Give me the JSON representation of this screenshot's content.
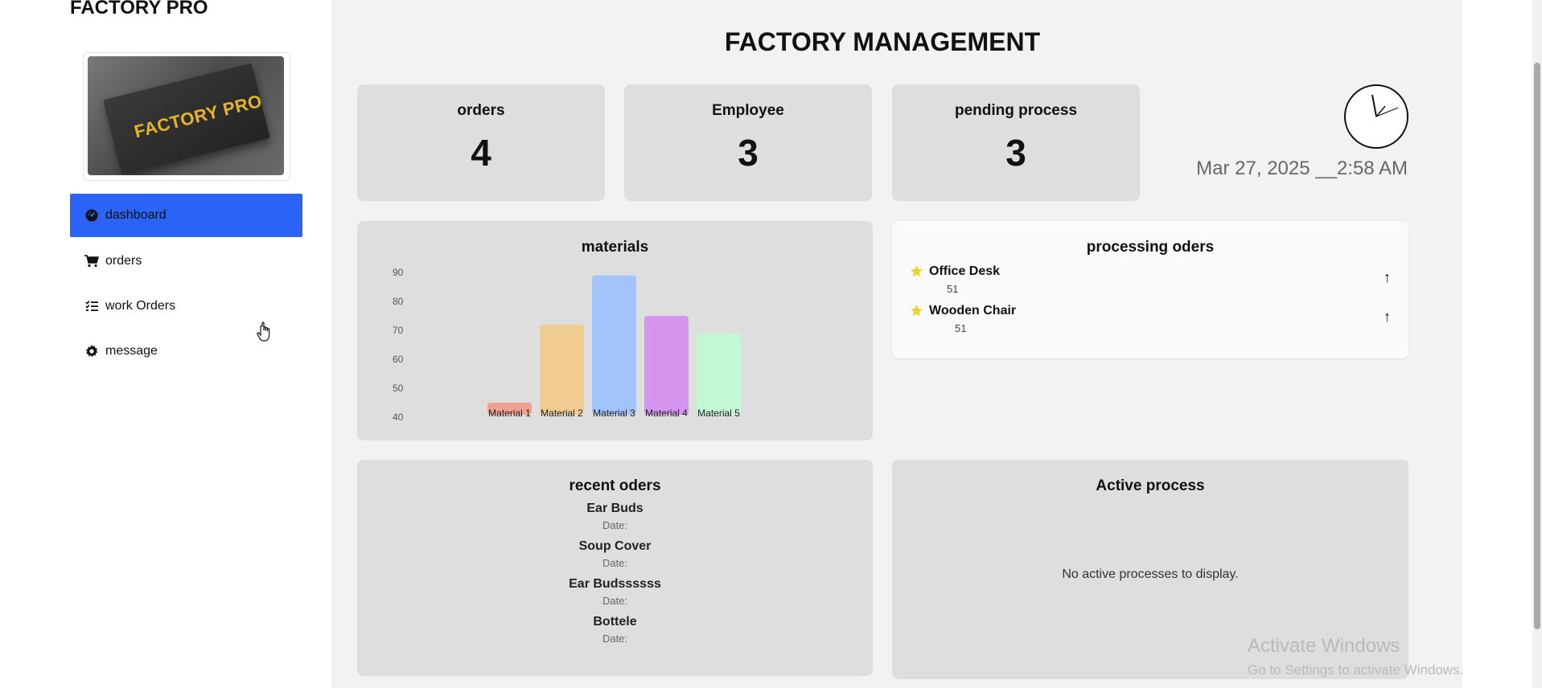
{
  "brand": "FACTORY PRO",
  "logo_text": "FACTORY PRO",
  "nav": [
    {
      "label": "dashboard",
      "icon": "dashboard-icon",
      "active": true
    },
    {
      "label": "orders",
      "icon": "cart-icon",
      "active": false
    },
    {
      "label": "work Orders",
      "icon": "list-check-icon",
      "active": false
    },
    {
      "label": "message",
      "icon": "gear-icon",
      "active": false
    }
  ],
  "title": "FACTORY MANAGEMENT",
  "stats": [
    {
      "label": "orders",
      "value": "4"
    },
    {
      "label": "Employee",
      "value": "3"
    },
    {
      "label": "pending process",
      "value": "3"
    }
  ],
  "clock": {
    "datetime": "Mar 27, 2025 __2:58 AM"
  },
  "materials_panel": {
    "title": "materials"
  },
  "chart_data": {
    "type": "bar",
    "title": "materials",
    "categories": [
      "Material 1",
      "Material 2",
      "Material 3",
      "Material 4",
      "Material 5"
    ],
    "values": [
      45,
      72,
      89,
      75,
      69
    ],
    "colors": [
      "#f4a090",
      "#f0cc92",
      "#a2c4fb",
      "#d595ef",
      "#c4f8d4"
    ],
    "ylim": [
      40,
      90
    ],
    "yticks": [
      40,
      50,
      60,
      70,
      80,
      90
    ],
    "grid": false
  },
  "processing": {
    "title": "processing oders",
    "items": [
      {
        "name": "Office Desk",
        "qty": "51",
        "arrow": "↑"
      },
      {
        "name": "Wooden Chair",
        "qty": "51",
        "arrow": "↑"
      }
    ]
  },
  "recent": {
    "title": "recent oders",
    "items": [
      {
        "name": "Ear Buds",
        "date": "Date:"
      },
      {
        "name": "Soup Cover",
        "date": "Date:"
      },
      {
        "name": "Ear Budssssss",
        "date": "Date:"
      },
      {
        "name": "Bottele",
        "date": "Date:"
      }
    ]
  },
  "active": {
    "title": "Active process",
    "empty": "No active processes to display."
  },
  "watermark": {
    "line1": "Activate Windows",
    "line2": "Go to Settings to activate Windows."
  }
}
